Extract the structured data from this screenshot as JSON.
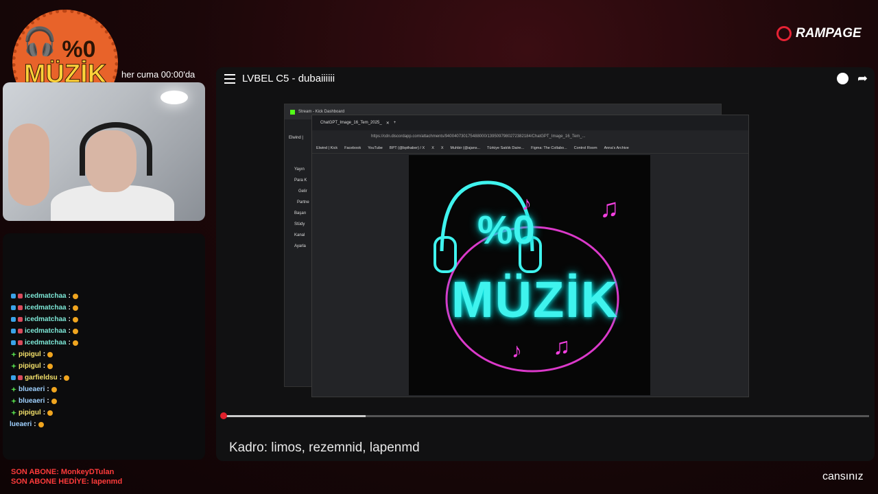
{
  "overlay": {
    "logo_percent": "%0",
    "logo_text": "MÜZİK",
    "schedule": "her cuma 00:00'da",
    "brand": "RAMPAGE",
    "streamer_name": "cansınız"
  },
  "chat": [
    {
      "name": "icedmatchaa",
      "badges": "sub"
    },
    {
      "name": "icedmatchaa",
      "badges": "sub"
    },
    {
      "name": "icedmatchaa",
      "badges": "sub"
    },
    {
      "name": "icedmatchaa",
      "badges": "sub"
    },
    {
      "name": "icedmatchaa",
      "badges": "sub"
    },
    {
      "name": "pipigul",
      "badges": "og"
    },
    {
      "name": "pipigul",
      "badges": "og"
    },
    {
      "name": "garfieldsu",
      "badges": "sub"
    },
    {
      "name": "blueaeri",
      "badges": "og"
    },
    {
      "name": "blueaeri",
      "badges": "og"
    },
    {
      "name": "pipigul",
      "badges": "og"
    },
    {
      "name": "lueaeri",
      "badges": "none"
    }
  ],
  "chat_suffix": " :",
  "subs": {
    "last_sub": "SON ABONE: MonkeyDTulan",
    "last_gift": "SON ABONE HEDİYE: lapenmd"
  },
  "player": {
    "title": "LVBEL C5 - dubaiiiiii",
    "caption": "Kadro: limos, rezemnid, lapenmd",
    "progress_fraction": 0.22,
    "position_fraction": 0.0
  },
  "kick_window": {
    "tab": "Stream - Kick Dashboard",
    "bookmark": "Elwind |",
    "sidebar": [
      "Yayın",
      "Para K",
      "Gelir",
      "Partne",
      "Başarı",
      "Stüdy",
      "Kanal",
      "Ayarla"
    ]
  },
  "discord_window": {
    "tab": "ChatGPT_Image_16_Tem_2025_",
    "url": "https://cdn.discordapp.com/attachments/940040730175488000/1395097980272382184/ChatGPT_Image_16_Tem_...",
    "bookmarks": [
      "Elwind | Kick",
      "Facebook",
      "YouTube",
      "BPT (@bpthaber) / X",
      "X",
      "X",
      "Muhbir (@ajans...",
      "Türkiye Satılık Daire...",
      "Figma: The Collabo...",
      "Control Room",
      "Anna's Archive"
    ]
  },
  "artwork": {
    "percent": "%0",
    "text": "MÜZİK"
  },
  "colors": {
    "neon_cyan": "#3ff3ee",
    "neon_pink": "#f33fe0",
    "logo_orange": "#e8632a",
    "brand_red": "#e52234",
    "kick_green": "#53fc18"
  }
}
